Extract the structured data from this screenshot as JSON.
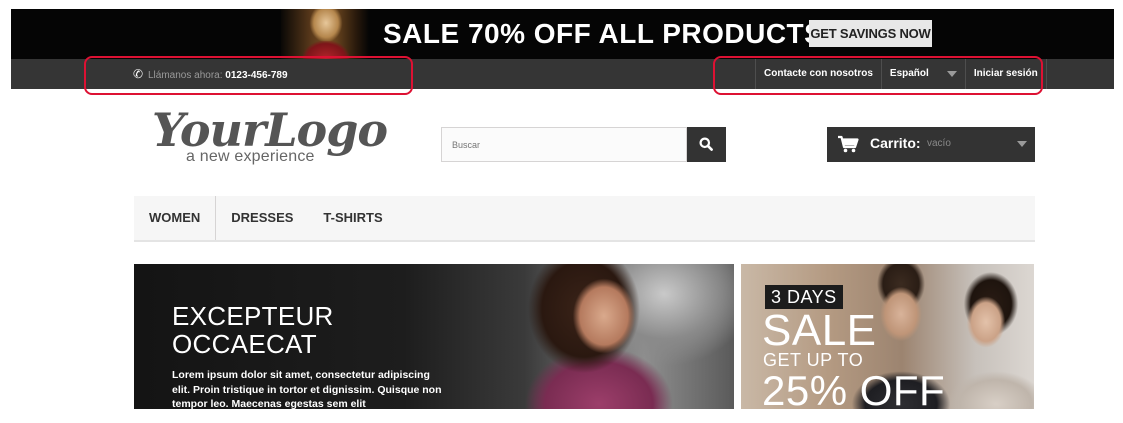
{
  "promo": {
    "headline": "SALE 70% OFF ALL PRODUCTS",
    "button": "GET SAVINGS NOW"
  },
  "topbar": {
    "call_label": "Llámanos ahora:",
    "phone": "0123-456-789",
    "contact": "Contacte con nosotros",
    "language": "Español",
    "login": "Iniciar sesión"
  },
  "logo": {
    "main": "YourLogo",
    "tagline": "a new experience"
  },
  "search": {
    "placeholder": "Buscar"
  },
  "cart": {
    "label": "Carrito:",
    "status": "vacío"
  },
  "menu": {
    "items": [
      "WOMEN",
      "DRESSES",
      "T-SHIRTS"
    ]
  },
  "hero": {
    "title_line1": "EXCEPTEUR",
    "title_line2": "OCCAECAT",
    "text": "Lorem ipsum dolor sit amet, consectetur adipiscing elit. Proin tristique in tortor et dignissim. Quisque non tempor leo. Maecenas egestas sem elit"
  },
  "side_banner": {
    "days": "3 DAYS",
    "sale": "SALE",
    "get_up_to": "GET UP TO",
    "discount": "25% OFF"
  },
  "colors": {
    "highlight": "#dd1133",
    "topbar": "#353535",
    "dark_button": "#333333"
  }
}
